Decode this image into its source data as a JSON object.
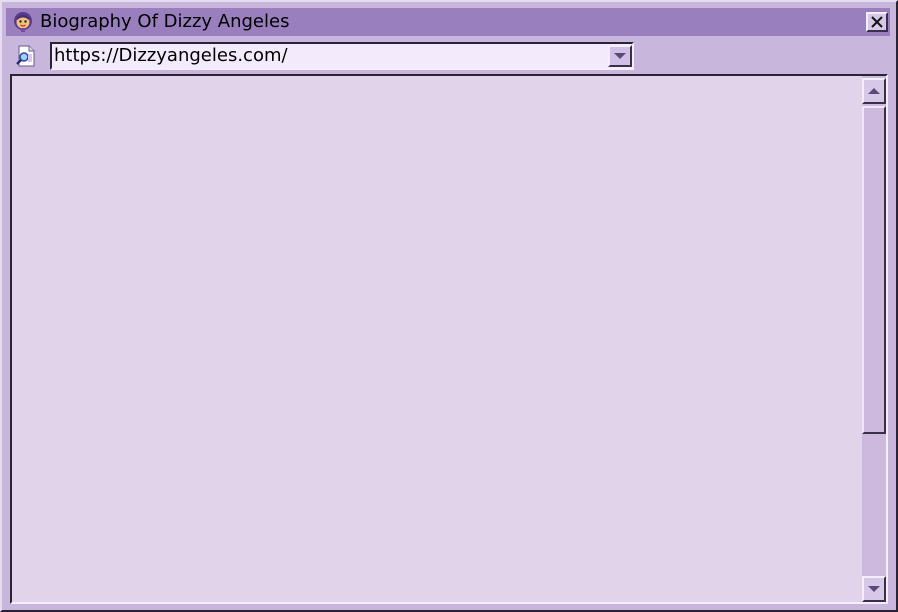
{
  "window": {
    "title": "Biography Of Dizzy Angeles",
    "icon": "character-face-icon",
    "close_icon": "close-icon"
  },
  "address_bar": {
    "icon": "page-search-icon",
    "value": "https://Dizzyangeles.com/",
    "dropdown_icon": "chevron-down-icon"
  },
  "scrollbar": {
    "up_icon": "arrow-up-icon",
    "down_icon": "arrow-down-icon",
    "thumb_position": 0.0
  },
  "colors": {
    "titlebar": "#9a7fbf",
    "window_bg": "#c9b6dd",
    "content_bg": "#e1d3ea",
    "address_bg": "#f3eafb"
  }
}
